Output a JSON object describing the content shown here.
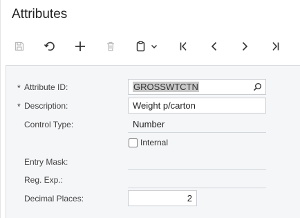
{
  "page": {
    "title": "Attributes"
  },
  "toolbar": {
    "icons": [
      "save-icon",
      "undo-icon",
      "add-icon",
      "delete-icon",
      "clipboard-icon",
      "chevron-down-icon",
      "first-page-icon",
      "previous-icon",
      "next-icon",
      "last-page-icon"
    ]
  },
  "form": {
    "attribute_id": {
      "label": "Attribute ID:",
      "required_mark": "*",
      "value": "GROSSWTCTN"
    },
    "description": {
      "label": "Description:",
      "required_mark": "*",
      "value": "Weight p/carton"
    },
    "control_type": {
      "label": "Control Type:",
      "value": "Number"
    },
    "internal": {
      "label": "Internal",
      "checked": false
    },
    "entry_mask": {
      "label": "Entry Mask:",
      "value": ""
    },
    "reg_exp": {
      "label": "Reg. Exp.:",
      "value": ""
    },
    "decimal_places": {
      "label": "Decimal Places:",
      "value": "2"
    }
  },
  "colors": {
    "icon": "#333333",
    "icon_disabled": "#b8b8b8",
    "panel_bg": "#f5f6f8"
  }
}
